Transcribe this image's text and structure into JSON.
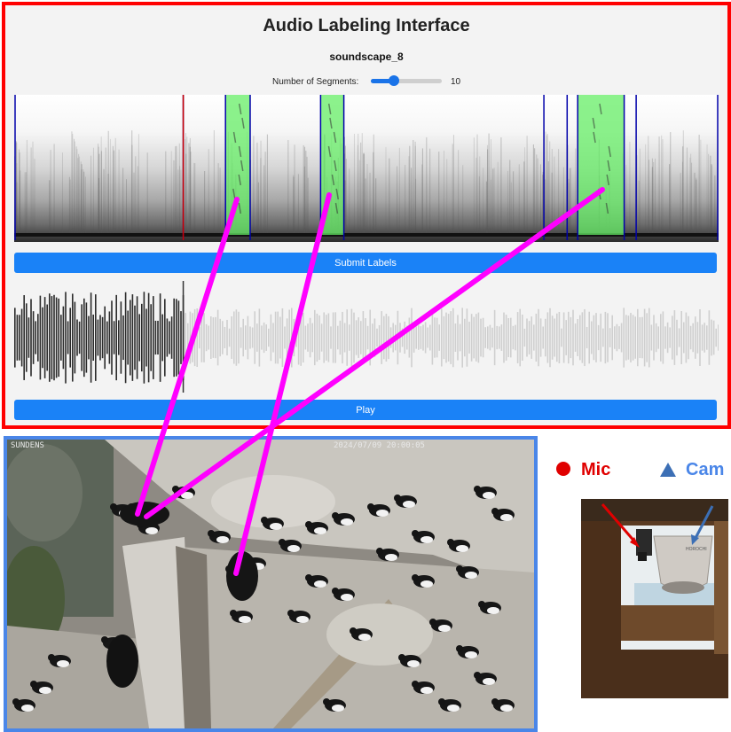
{
  "app": {
    "title": "Audio Labeling Interface",
    "file_name": "soundscape_8",
    "segments_label": "Number of Segments:",
    "segments_value": 10,
    "segments_fraction": 0.33,
    "submit_label": "Submit Labels",
    "play_label": "Play",
    "playback_fraction": 0.24
  },
  "spectrogram": {
    "segment_boundaries": [
      0.0,
      0.24,
      0.3,
      0.335,
      0.435,
      0.468,
      0.752,
      0.785,
      0.8,
      0.866,
      0.883,
      1.0
    ],
    "labeled_segments": [
      [
        0.3,
        0.335
      ],
      [
        0.435,
        0.468
      ],
      [
        0.8,
        0.866
      ]
    ],
    "label_color": "#66ee66",
    "boundary_color": "#0000aa",
    "cursor_color": "#cc0000"
  },
  "video": {
    "osd_left": "SUNDENS",
    "osd_right": "2024/07/09 20:00:05",
    "frame_color": "#4a86e8"
  },
  "legend": {
    "mic_label": "Mic",
    "mic_color": "#e00000",
    "cam_label": "Cam",
    "cam_color": "#4a86e8"
  },
  "photo": {
    "camera_text": "HOROCHI"
  },
  "annotations": {
    "link_color": "#ff00ff",
    "frame_color": "#ff0000"
  }
}
